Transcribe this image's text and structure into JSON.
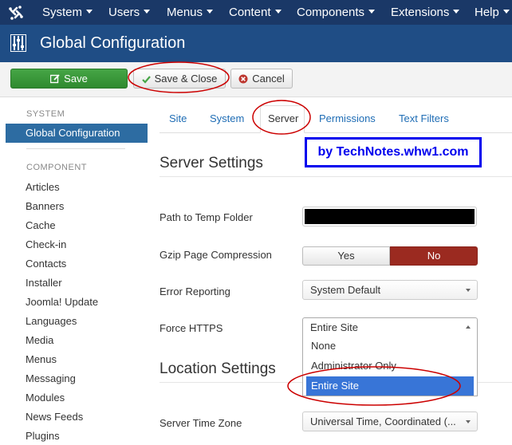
{
  "topnav": {
    "items": [
      {
        "label": "System"
      },
      {
        "label": "Users"
      },
      {
        "label": "Menus"
      },
      {
        "label": "Content"
      },
      {
        "label": "Components"
      },
      {
        "label": "Extensions"
      },
      {
        "label": "Help"
      }
    ]
  },
  "header": {
    "title": "Global Configuration"
  },
  "toolbar": {
    "save_label": "Save",
    "save_close_label": "Save & Close",
    "cancel_label": "Cancel"
  },
  "sidebar": {
    "system_heading": "SYSTEM",
    "active_item": "Global Configuration",
    "component_heading": "COMPONENT",
    "items": [
      "Articles",
      "Banners",
      "Cache",
      "Check-in",
      "Contacts",
      "Installer",
      "Joomla! Update",
      "Languages",
      "Media",
      "Menus",
      "Messaging",
      "Modules",
      "News Feeds",
      "Plugins"
    ]
  },
  "tabs": [
    "Site",
    "System",
    "Server",
    "Permissions",
    "Text Filters"
  ],
  "watermark": "by TechNotes.whw1.com",
  "server_settings": {
    "title": "Server Settings",
    "temp_folder_label": "Path to Temp Folder",
    "gzip_label": "Gzip Page Compression",
    "gzip_yes": "Yes",
    "gzip_no": "No",
    "error_label": "Error Reporting",
    "error_value": "System Default",
    "https_label": "Force HTTPS",
    "https_value": "Entire Site",
    "https_options": [
      "None",
      "Administrator Only",
      "Entire Site"
    ]
  },
  "location_settings": {
    "title": "Location Settings",
    "timezone_label": "Server Time Zone",
    "timezone_value": "Universal Time, Coordinated (..."
  },
  "colors": {
    "topnav": "#1a3867",
    "header": "#1f4d85",
    "save_button": "#46a546",
    "no_toggle": "#9b2a20",
    "selected_option": "#3875d7",
    "annotation": "#cc0000",
    "watermark": "#0000ee"
  }
}
